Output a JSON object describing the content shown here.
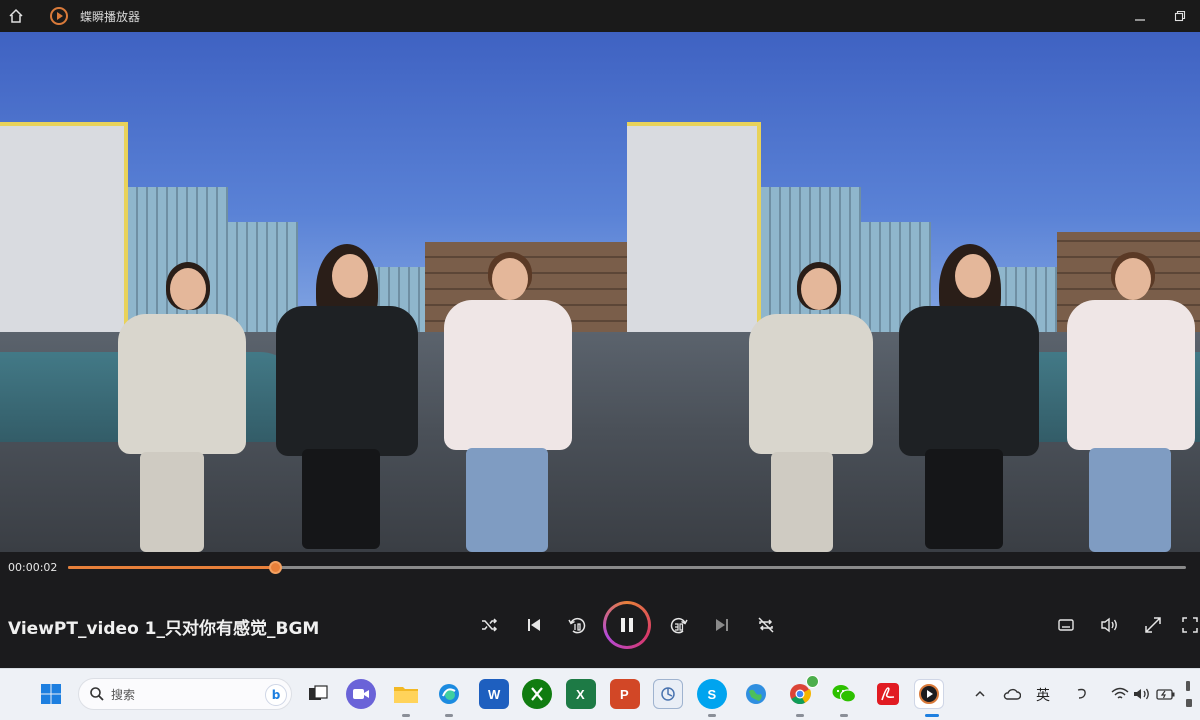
{
  "app": {
    "title": "蝶瞬播放器"
  },
  "player": {
    "current_time": "00:00:02",
    "progress_fraction": 0.185,
    "video_title": "ViewPT_video 1_只对你有感觉_BGM"
  },
  "taskbar": {
    "search_placeholder": "搜索",
    "tray_ime": "英",
    "colors": {
      "accent": "#e8803a",
      "taskbar_bg": "#eef1f6"
    }
  }
}
